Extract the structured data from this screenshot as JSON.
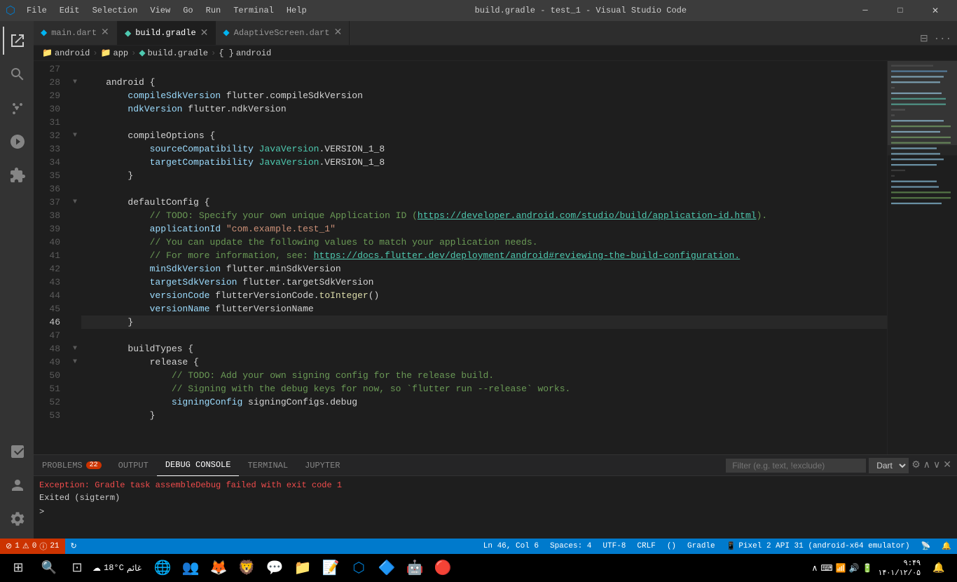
{
  "titleBar": {
    "title": "build.gradle - test_1 - Visual Studio Code",
    "menuItems": [
      "File",
      "Edit",
      "Selection",
      "View",
      "Go",
      "Run",
      "Terminal",
      "Help"
    ]
  },
  "tabs": [
    {
      "id": "main-dart",
      "label": "main.dart",
      "icon": "dart",
      "active": false,
      "modified": false
    },
    {
      "id": "build-gradle",
      "label": "build.gradle",
      "icon": "gradle",
      "active": true,
      "modified": true
    },
    {
      "id": "adaptive-screen",
      "label": "AdaptiveScreen.dart",
      "icon": "dart",
      "active": false,
      "modified": false
    }
  ],
  "breadcrumb": {
    "items": [
      "android",
      "app",
      "build.gradle",
      "android"
    ]
  },
  "codeLines": [
    {
      "num": "27",
      "content": ""
    },
    {
      "num": "28",
      "content": "    android {",
      "fold": true
    },
    {
      "num": "29",
      "content": "        compileSdkVersion flutter.compileSdkVersion",
      "parts": [
        {
          "t": "        ",
          "c": ""
        },
        {
          "t": "compileSdkVersion",
          "c": "prop"
        },
        {
          "t": " flutter.compileSdkVersion",
          "c": ""
        }
      ]
    },
    {
      "num": "30",
      "content": "        ndkVersion flutter.ndkVersion",
      "parts": [
        {
          "t": "        ",
          "c": ""
        },
        {
          "t": "ndkVersion",
          "c": "prop"
        },
        {
          "t": " flutter.ndkVersion",
          "c": ""
        }
      ]
    },
    {
      "num": "31",
      "content": ""
    },
    {
      "num": "32",
      "content": "        compileOptions {",
      "fold": true
    },
    {
      "num": "33",
      "content": "            sourceCompatibility JavaVersion.VERSION_1_8",
      "parts": [
        {
          "t": "            ",
          "c": ""
        },
        {
          "t": "sourceCompatibility",
          "c": "prop"
        },
        {
          "t": " ",
          "c": ""
        },
        {
          "t": "JavaVersion",
          "c": "cls"
        },
        {
          "t": ".VERSION_1_8",
          "c": ""
        }
      ]
    },
    {
      "num": "34",
      "content": "            targetCompatibility JavaVersion.VERSION_1_8",
      "parts": [
        {
          "t": "            ",
          "c": ""
        },
        {
          "t": "targetCompatibility",
          "c": "prop"
        },
        {
          "t": " ",
          "c": ""
        },
        {
          "t": "JavaVersion",
          "c": "cls"
        },
        {
          "t": ".VERSION_1_8",
          "c": ""
        }
      ]
    },
    {
      "num": "35",
      "content": "        }"
    },
    {
      "num": "36",
      "content": ""
    },
    {
      "num": "37",
      "content": "        defaultConfig {",
      "fold": true
    },
    {
      "num": "38",
      "content": "            // TODO: Specify your own unique Application ID (https://developer.android.com/studio/build/application-id.html).",
      "cmt": true
    },
    {
      "num": "39",
      "content": "            applicationId \"com.example.test_1\"",
      "parts": [
        {
          "t": "            ",
          "c": ""
        },
        {
          "t": "applicationId",
          "c": "prop"
        },
        {
          "t": " ",
          "c": ""
        },
        {
          "t": "\"com.example.test_1\"",
          "c": "str"
        }
      ]
    },
    {
      "num": "40",
      "content": "            // You can update the following values to match your application needs.",
      "cmt": true
    },
    {
      "num": "41",
      "content": "            // For more information, see: https://docs.flutter.dev/deployment/android#reviewing-the-build-configuration.",
      "cmt": true
    },
    {
      "num": "42",
      "content": "            minSdkVersion flutter.minSdkVersion",
      "parts": [
        {
          "t": "            ",
          "c": ""
        },
        {
          "t": "minSdkVersion",
          "c": "prop"
        },
        {
          "t": " flutter.minSdkVersion",
          "c": ""
        }
      ]
    },
    {
      "num": "43",
      "content": "            targetSdkVersion flutter.targetSdkVersion",
      "parts": [
        {
          "t": "            ",
          "c": ""
        },
        {
          "t": "targetSdkVersion",
          "c": "prop"
        },
        {
          "t": " flutter.targetSdkVersion",
          "c": ""
        }
      ]
    },
    {
      "num": "44",
      "content": "            versionCode flutterVersionCode.toInteger()",
      "parts": [
        {
          "t": "            ",
          "c": ""
        },
        {
          "t": "versionCode",
          "c": "prop"
        },
        {
          "t": " ",
          "c": ""
        },
        {
          "t": "flutterVersionCode",
          "c": ""
        },
        {
          "t": ".",
          "c": ""
        },
        {
          "t": "toInteger",
          "c": "fn"
        },
        {
          "t": "()",
          "c": ""
        }
      ]
    },
    {
      "num": "45",
      "content": "            versionName flutterVersionName",
      "parts": [
        {
          "t": "            ",
          "c": ""
        },
        {
          "t": "versionName",
          "c": "prop"
        },
        {
          "t": " flutterVersionName",
          "c": ""
        }
      ]
    },
    {
      "num": "46",
      "content": "        }",
      "active": true
    },
    {
      "num": "47",
      "content": ""
    },
    {
      "num": "48",
      "content": "        buildTypes {",
      "fold": true
    },
    {
      "num": "49",
      "content": "            release {",
      "fold": true
    },
    {
      "num": "50",
      "content": "                // TODO: Add your own signing config for the release build.",
      "cmt": true
    },
    {
      "num": "51",
      "content": "                // Signing with the debug keys for now, so `flutter run --release` works.",
      "cmt": true
    },
    {
      "num": "52",
      "content": "                signingConfig signingConfigs.debug",
      "parts": [
        {
          "t": "                ",
          "c": ""
        },
        {
          "t": "signingConfig",
          "c": "prop"
        },
        {
          "t": " signingConfigs.debug",
          "c": ""
        }
      ]
    },
    {
      "num": "53",
      "content": "            }"
    }
  ],
  "panel": {
    "tabs": [
      {
        "id": "problems",
        "label": "PROBLEMS",
        "badge": "22",
        "badgeType": "error",
        "active": false
      },
      {
        "id": "output",
        "label": "OUTPUT",
        "active": false
      },
      {
        "id": "debug-console",
        "label": "DEBUG CONSOLE",
        "active": true
      },
      {
        "id": "terminal",
        "label": "TERMINAL",
        "active": false
      },
      {
        "id": "jupyter",
        "label": "JUPYTER",
        "active": false
      }
    ],
    "filterPlaceholder": "Filter (e.g. text, !exclude)",
    "langSelect": "Dart",
    "consoleLines": [
      {
        "type": "error",
        "text": "Exception: Gradle task assembleDebug failed with exit code 1"
      },
      {
        "type": "normal",
        "text": "Exited (sigterm)"
      }
    ],
    "prompt": ">"
  },
  "statusBar": {
    "left": [
      {
        "id": "errors",
        "text": "⚠ 1  ⚠ 0  ⓘ 21",
        "type": "error"
      },
      {
        "id": "sync",
        "icon": "sync",
        "text": ""
      }
    ],
    "right": [
      {
        "id": "position",
        "text": "Ln 46, Col 6"
      },
      {
        "id": "spaces",
        "text": "Spaces: 4"
      },
      {
        "id": "encoding",
        "text": "UTF-8"
      },
      {
        "id": "eol",
        "text": "CRLF"
      },
      {
        "id": "parens",
        "text": "()"
      },
      {
        "id": "lang",
        "text": "Gradle"
      },
      {
        "id": "device",
        "text": "Pixel 2 API 31 (android-x64 emulator)"
      },
      {
        "id": "broadcast",
        "icon": "📡",
        "text": ""
      },
      {
        "id": "bell",
        "icon": "🔔",
        "text": ""
      }
    ]
  },
  "taskbar": {
    "apps": [
      {
        "id": "start",
        "icon": "⊞",
        "label": "Start"
      },
      {
        "id": "search",
        "icon": "🔍",
        "label": "Search"
      },
      {
        "id": "taskview",
        "icon": "⊡",
        "label": "Task View"
      },
      {
        "id": "edge",
        "icon": "🌐",
        "label": "Edge"
      },
      {
        "id": "firefox",
        "icon": "🦊",
        "label": "Firefox"
      },
      {
        "id": "brave",
        "icon": "🦁",
        "label": "Brave"
      },
      {
        "id": "discord",
        "icon": "💬",
        "label": "Discord"
      },
      {
        "id": "files",
        "icon": "📁",
        "label": "Files"
      },
      {
        "id": "notes",
        "icon": "📝",
        "label": "Notes"
      },
      {
        "id": "vscode",
        "icon": "💙",
        "label": "VS Code"
      },
      {
        "id": "flutter",
        "icon": "🔷",
        "label": "Flutter"
      },
      {
        "id": "android",
        "icon": "🤖",
        "label": "Android"
      },
      {
        "id": "browser2",
        "icon": "🔴",
        "label": "App"
      }
    ],
    "tray": {
      "network": "WiFi",
      "volume": "🔊",
      "battery": "🔋",
      "clock": "۹:۴۹",
      "date": "۱۴۰۱/۱۲/۰۵"
    }
  }
}
